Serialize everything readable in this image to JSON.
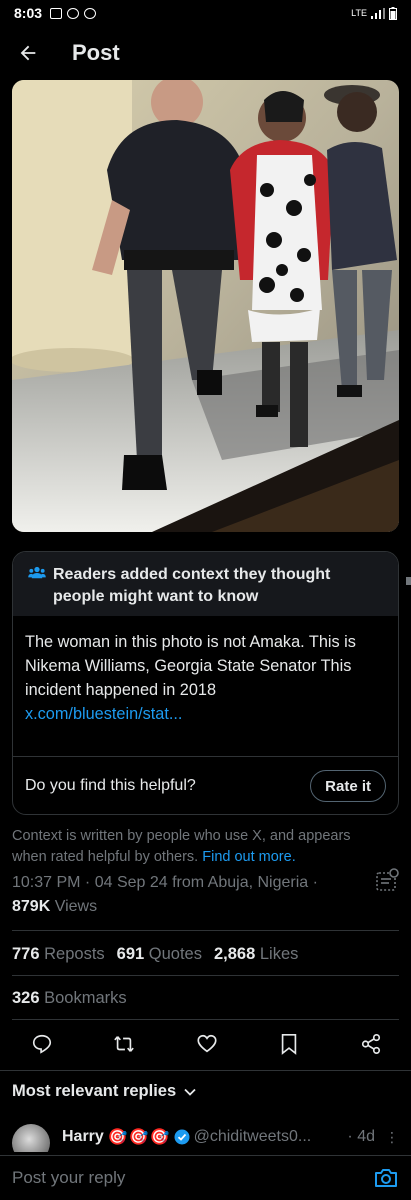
{
  "status_bar": {
    "time": "8:03",
    "network": "LTE",
    "icons": [
      "gallery-icon",
      "msg-icon",
      "facebook-icon",
      "signal-icon",
      "battery-icon"
    ]
  },
  "header": {
    "title": "Post",
    "back_icon": "arrow-left-icon"
  },
  "community_note": {
    "heading": "Readers added context they thought people might want to know",
    "body": "The woman in this photo is not Amaka. This is Nikema Williams, Georgia State Senator This incident happened in 2018",
    "link": "x.com/bluestein/stat...",
    "question": "Do you find this helpful?",
    "rate_label": "Rate it"
  },
  "context": {
    "text": "Context is written by people who use X, and appears when rated helpful by others.",
    "find_out_more": "Find out more."
  },
  "post_meta": {
    "timestamp": "10:37 PM · 04 Sep 24 from Abuja, Nigeria ·",
    "views_count": "879K",
    "views_label": "Views"
  },
  "stats": {
    "reposts_count": "776",
    "reposts_label": "Reposts",
    "quotes_count": "691",
    "quotes_label": "Quotes",
    "likes_count": "2,868",
    "likes_label": "Likes",
    "bookmarks_count": "326",
    "bookmarks_label": "Bookmarks"
  },
  "replies": {
    "sort_label": "Most relevant replies",
    "items": [
      {
        "name": "Harry",
        "emoji": [
          "🎯",
          "🎯",
          "🎯"
        ],
        "handle": "@chiditweets0...",
        "time": "· 4d"
      }
    ]
  },
  "composer": {
    "placeholder": "Post your reply"
  },
  "colors": {
    "background": "#000000",
    "text": "#e7e9ea",
    "muted": "#71767b",
    "link": "#1d9bf0",
    "border": "#2f3336"
  }
}
